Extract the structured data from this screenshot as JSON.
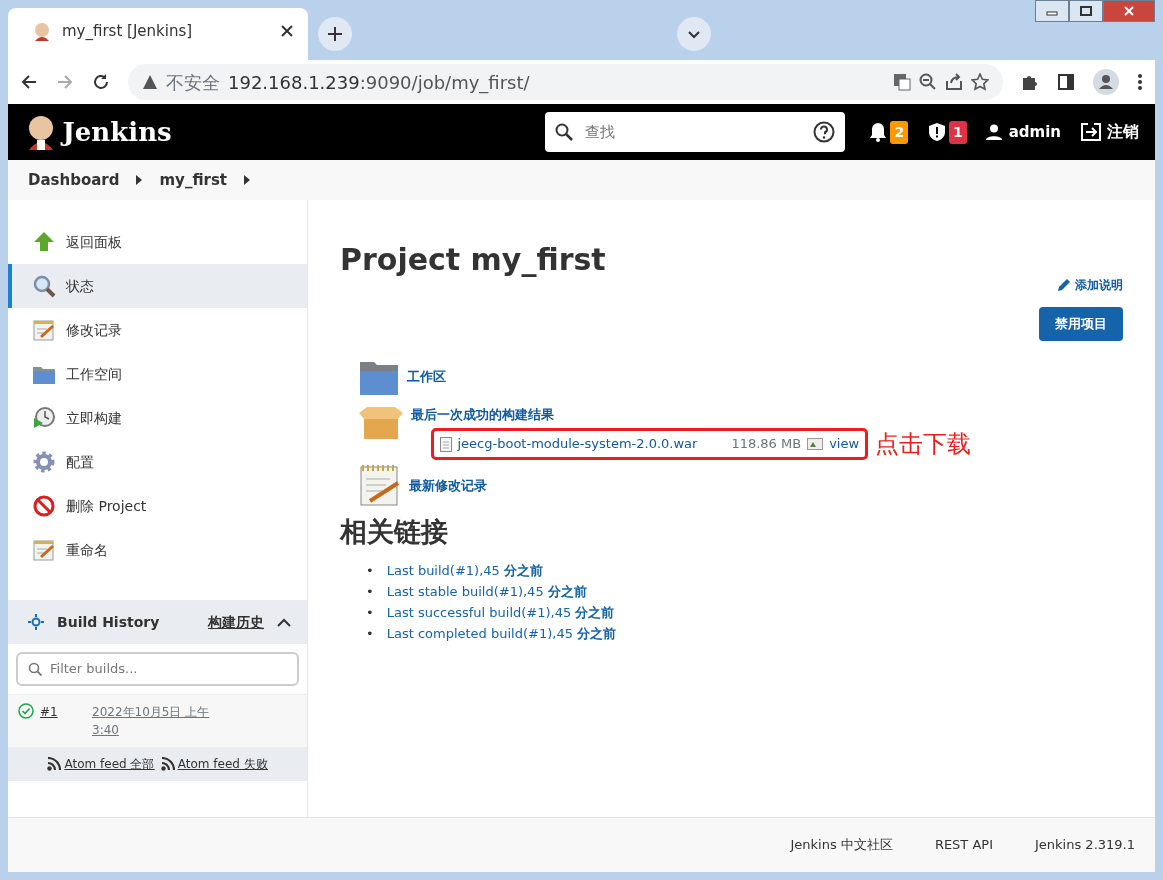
{
  "browser": {
    "tab_title": "my_first [Jenkins]",
    "url_warning": "不安全",
    "url_host": "192.168.1.239",
    "url_rest": ":9090/job/my_first/"
  },
  "header": {
    "brand": "Jenkins",
    "search": {
      "placeholder": "查找"
    },
    "notifications": "2",
    "security": "1",
    "user": "admin",
    "logout": "注销"
  },
  "breadcrumbs": [
    "Dashboard",
    "my_first"
  ],
  "sidebar": {
    "items": [
      {
        "label": "返回面板",
        "kind": "up",
        "selected": false
      },
      {
        "label": "状态",
        "kind": "search",
        "selected": true
      },
      {
        "label": "修改记录",
        "kind": "notepad",
        "selected": false
      },
      {
        "label": "工作空间",
        "kind": "folder",
        "selected": false
      },
      {
        "label": "立即构建",
        "kind": "clock",
        "selected": false
      },
      {
        "label": "配置",
        "kind": "gear",
        "selected": false
      },
      {
        "label": "删除 Project",
        "kind": "forbid",
        "selected": false
      },
      {
        "label": "重命名",
        "kind": "notepad",
        "selected": false
      }
    ]
  },
  "build_history": {
    "title": "Build History",
    "link": "构建历史",
    "expanded": true,
    "filter": {
      "placeholder": "Filter builds..."
    },
    "builds": [
      {
        "number": "#1",
        "time": "2022年10月5日 上午 3:40",
        "kind": "success"
      }
    ],
    "feeds": [
      "Atom feed 全部",
      "Atom feed 失败"
    ]
  },
  "main": {
    "title": "Project my_first",
    "add_description": "添加说明",
    "disable_button": "禁用项目",
    "workspace": "工作区",
    "last_success": "最后一次成功的构建结果",
    "artifact": {
      "file": "jeecg-boot-module-system-2.0.0.war",
      "size": "118.86 MB",
      "view": "view"
    },
    "changes": "最新修改记录",
    "annotation": "点击下载",
    "related_heading": "相关链接",
    "related_links": [
      {
        "bullet": "•",
        "text": "Last build(#1),45 **分之前**"
      },
      {
        "bullet": "•",
        "text": "Last stable build(#1),45 **分之前**"
      },
      {
        "bullet": "•",
        "text": "Last successful build(#1),45 **分之前**"
      },
      {
        "bullet": "•",
        "text": "Last completed build(#1),45 **分之前**"
      }
    ]
  },
  "footer": [
    "Jenkins 中文社区",
    "REST API",
    "Jenkins 2.319.1"
  ]
}
